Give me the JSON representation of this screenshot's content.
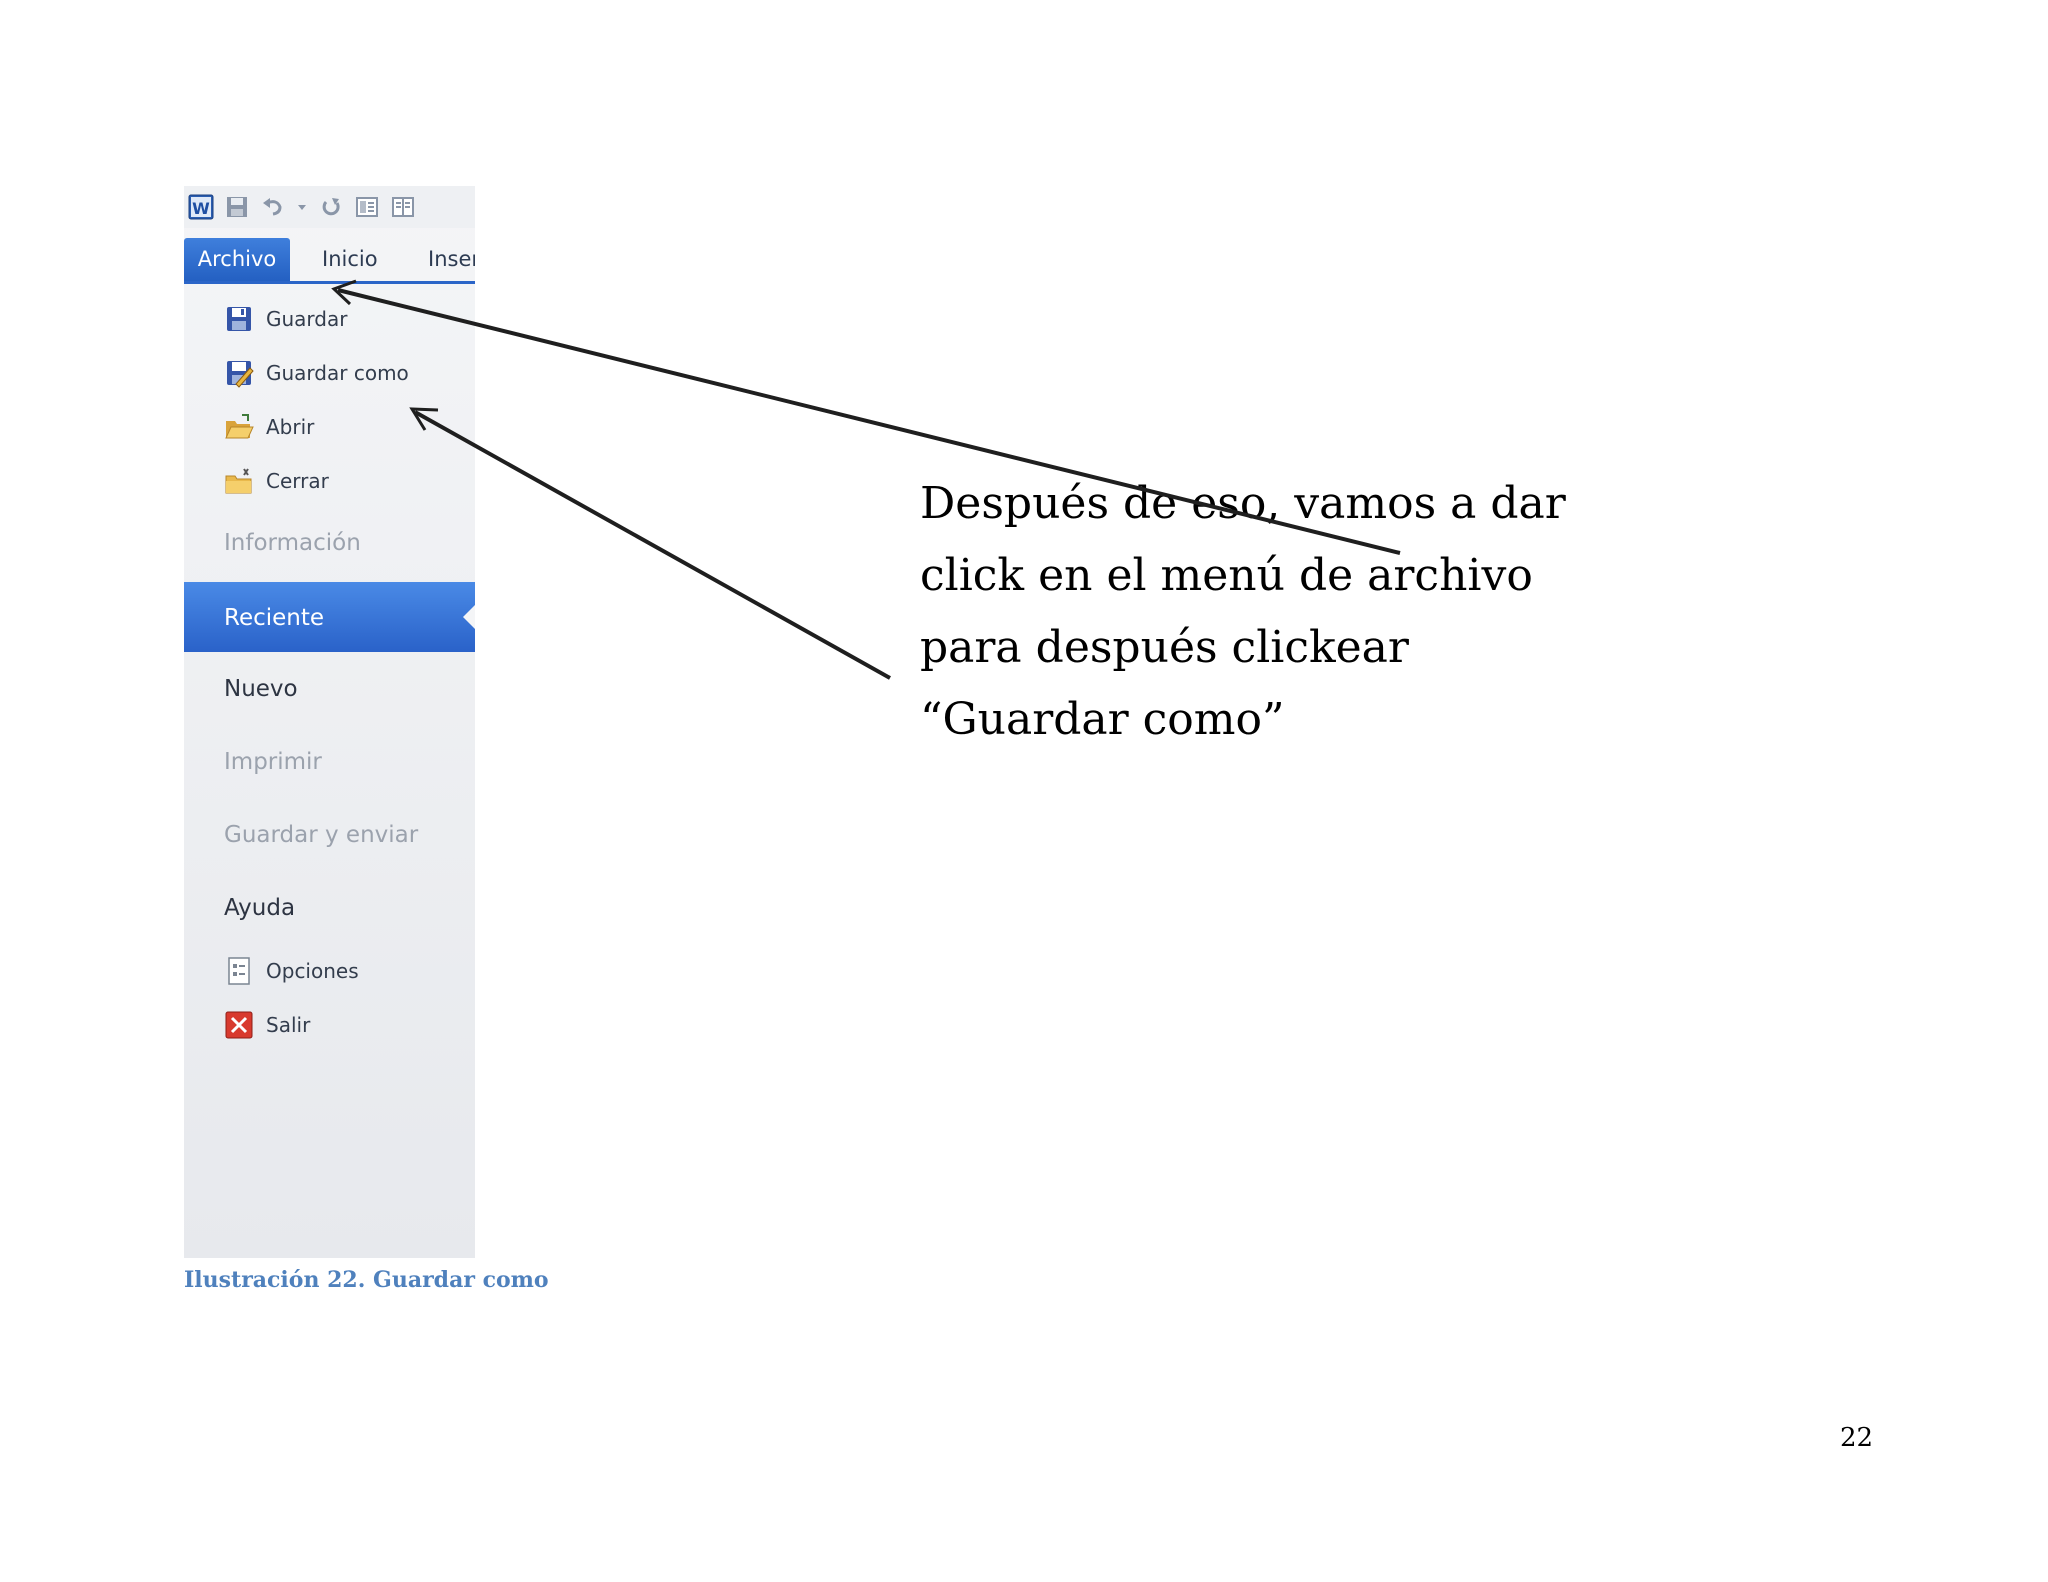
{
  "word_window": {
    "quick_access": [
      {
        "icon": "word-logo-icon"
      },
      {
        "icon": "save-icon"
      },
      {
        "icon": "undo-icon"
      },
      {
        "icon": "dropdown-arrow-icon"
      },
      {
        "icon": "redo-icon"
      },
      {
        "icon": "layout-icon"
      },
      {
        "icon": "layout-columns-icon"
      }
    ],
    "tabs": [
      {
        "label": "Archivo",
        "active": true
      },
      {
        "label": "Inicio",
        "active": false
      },
      {
        "label": "Inser",
        "active": false
      }
    ],
    "file_menu": {
      "commands": [
        {
          "label": "Guardar",
          "icon": "save-icon"
        },
        {
          "label": "Guardar como",
          "icon": "save-as-icon"
        },
        {
          "label": "Abrir",
          "icon": "open-folder-icon"
        },
        {
          "label": "Cerrar",
          "icon": "close-folder-icon"
        }
      ],
      "categories": [
        {
          "label": "Información",
          "enabled": false
        },
        {
          "label": "Reciente",
          "selected": true
        },
        {
          "label": "Nuevo",
          "enabled": true
        },
        {
          "label": "Imprimir",
          "enabled": false
        },
        {
          "label": "Guardar y enviar",
          "enabled": false
        },
        {
          "label": "Ayuda",
          "enabled": true
        }
      ],
      "bottom_commands": [
        {
          "label": "Opciones",
          "icon": "options-icon"
        },
        {
          "label": "Salir",
          "icon": "exit-icon"
        }
      ]
    }
  },
  "caption": "Ilustración 22. Guardar como",
  "annotation": {
    "lines": [
      "Después de eso, vamos a dar",
      "click en el menú de archivo",
      "para después clickear",
      "“Guardar como”"
    ]
  },
  "page_number": "22",
  "colors": {
    "accent_blue": "#2b65c8",
    "caption_blue": "#4f81bd",
    "arrow": "#1f1f1f"
  }
}
